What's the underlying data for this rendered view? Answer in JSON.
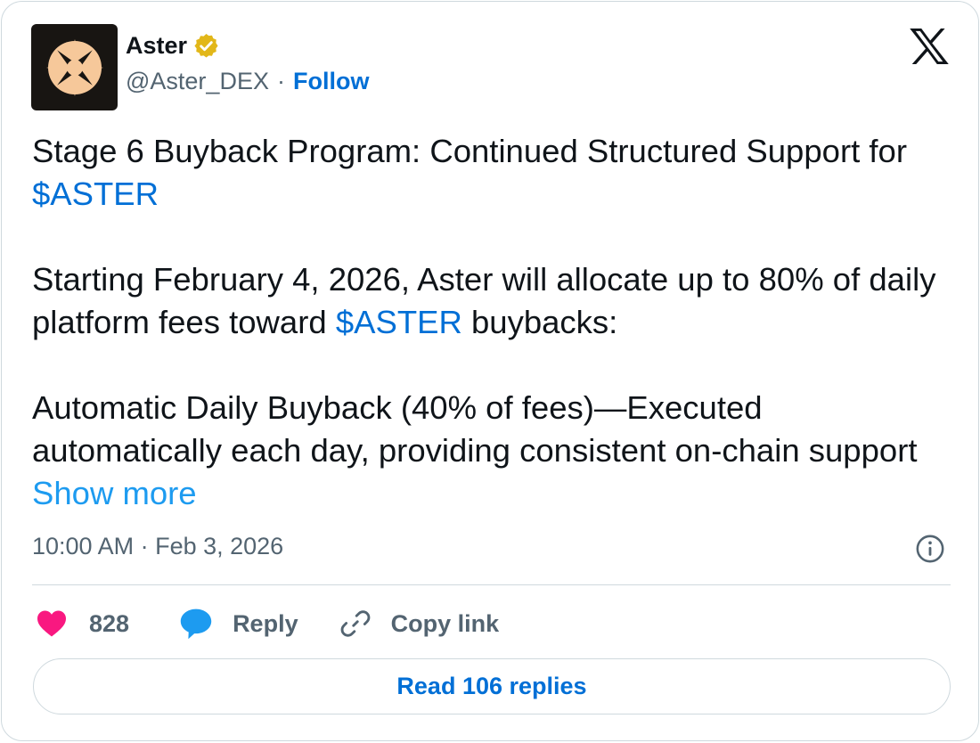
{
  "author": {
    "name": "Aster",
    "handle": "@Aster_DEX",
    "separator": "·",
    "follow_label": "Follow",
    "avatar_icon": "aster-star-logo",
    "verified_icon": "verified-gold-badge"
  },
  "platform_icon": "x-logo",
  "tweet": {
    "line1_text": "Stage 6 Buyback Program: Continued Structured Support for ",
    "line1_cashtag": "$ASTER",
    "para2_text": "Starting February 4, 2026, Aster will allocate up to 80% of daily platform fees toward ",
    "para2_cashtag": "$ASTER",
    "para2_tail": " buybacks:",
    "para3_text": "Automatic Daily Buyback (40% of fees)—Executed automatically each day, providing consistent on-chain support ",
    "show_more": "Show more"
  },
  "meta": {
    "timestamp": "10:00 AM · Feb 3, 2026",
    "info_icon": "info-icon"
  },
  "actions": {
    "like_count": "828",
    "reply_label": "Reply",
    "copy_label": "Copy link"
  },
  "read_replies_label": "Read 106 replies",
  "colors": {
    "link": "#006fd6",
    "show_more": "#1d9bf0",
    "like": "#f91880",
    "reply": "#1d9bf0",
    "muted": "#536471",
    "verified": "#e2b719",
    "avatar_bg": "#181512",
    "avatar_star": "#f6c89a"
  }
}
